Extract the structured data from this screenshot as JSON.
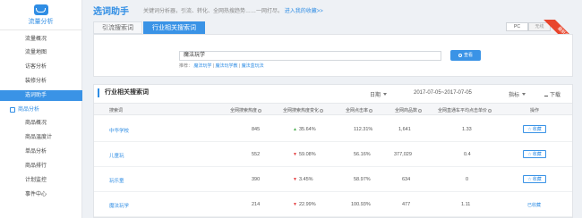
{
  "sidebar": {
    "logo_text": "流量分析",
    "items": [
      {
        "label": "流量概况",
        "state": "normal"
      },
      {
        "label": "流量地图",
        "state": "normal"
      },
      {
        "label": "访客分析",
        "state": "normal"
      },
      {
        "label": "装修分析",
        "state": "normal"
      },
      {
        "label": "选词助手",
        "state": "active"
      },
      {
        "label": "商品分析",
        "state": "group"
      },
      {
        "label": "商品概况",
        "state": "normal"
      },
      {
        "label": "商品温度计",
        "state": "normal"
      },
      {
        "label": "单品分析",
        "state": "normal"
      },
      {
        "label": "商品排行",
        "state": "normal"
      },
      {
        "label": "计划监控",
        "state": "normal"
      },
      {
        "label": "事件中心",
        "state": "normal"
      }
    ]
  },
  "header": {
    "title": "选词助手",
    "subtitle": "关键词分析器，引流、转化、全网热搜趋势……一网打尽。",
    "subtitle_link": "进入我的收藏>>"
  },
  "tabs": [
    {
      "label": "引流搜索词",
      "active": false
    },
    {
      "label": "行业相关搜索词",
      "active": true
    }
  ],
  "device_toggle": {
    "pc": "PC",
    "wireless": "无线",
    "selected": "wireless"
  },
  "ribbon": {
    "label": "最新升级"
  },
  "search": {
    "value": "魔法玩学",
    "button_label": "查看",
    "recommend_label": "推荐：",
    "recommend_links": [
      "魔法玩学",
      "魔法玩学教",
      "魔法盒玩法"
    ],
    "separator": " | "
  },
  "table": {
    "title": "行业相关搜索词",
    "date_label": "日期",
    "date_range": "2017-07-05~2017-07-05",
    "metric_label": "指标",
    "download_label": "下载",
    "headers": [
      "搜索词",
      "全网搜索热度",
      "全网搜索热度变化",
      "全网点击率",
      "全网商品数",
      "全网直通车平均点击单价",
      "操作"
    ],
    "rows": [
      {
        "keyword": "中华学校",
        "heat": "845",
        "change_dir": "up",
        "change": "35.64%",
        "ctr": "112.31%",
        "goods": "1,641",
        "cpc": "1.33",
        "action": "收藏",
        "action_type": "button"
      },
      {
        "keyword": "儿童玩",
        "heat": "552",
        "change_dir": "down",
        "change": "59.08%",
        "ctr": "56.16%",
        "goods": "377,029",
        "cpc": "0.4",
        "action": "收藏",
        "action_type": "button"
      },
      {
        "keyword": "玩乐童",
        "heat": "390",
        "change_dir": "down",
        "change": "3.45%",
        "ctr": "58.97%",
        "goods": "634",
        "cpc": "0",
        "action": "收藏",
        "action_type": "button"
      },
      {
        "keyword": "魔法玩学",
        "heat": "214",
        "change_dir": "down",
        "change": "22.99%",
        "ctr": "100.93%",
        "goods": "477",
        "cpc": "1.11",
        "action": "已收藏",
        "action_type": "text"
      }
    ]
  }
}
